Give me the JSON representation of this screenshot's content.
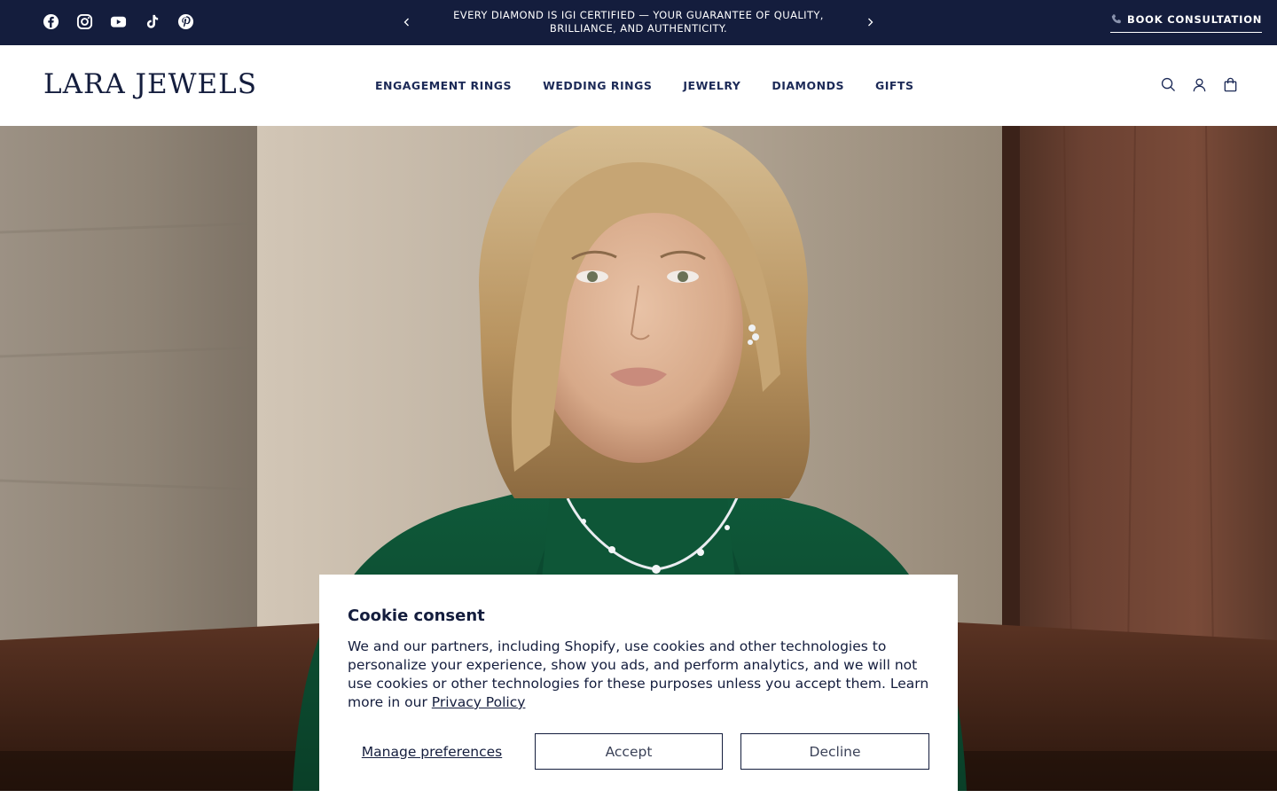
{
  "colors": {
    "navy": "#141d3d",
    "nav_text": "#1c2a57",
    "white": "#ffffff"
  },
  "announcement": {
    "social_icons": [
      "facebook-icon",
      "instagram-icon",
      "youtube-icon",
      "tiktok-icon",
      "pinterest-icon"
    ],
    "text": "EVERY DIAMOND IS IGI CERTIFIED — YOUR GUARANTEE OF QUALITY, BRILLIANCE, AND AUTHENTICITY.",
    "cta": "BOOK CONSULTATION"
  },
  "header": {
    "logo": "LARA JEWELS",
    "nav": [
      "ENGAGEMENT RINGS",
      "WEDDING RINGS",
      "JEWELRY",
      "DIAMONDS",
      "GIFTS"
    ],
    "icons": [
      "search-icon",
      "account-icon",
      "cart-icon"
    ]
  },
  "cookie": {
    "title": "Cookie consent",
    "body": "We and our partners, including Shopify, use cookies and other technologies to personalize your experience, show you ads, and perform analytics, and we will not use cookies or other technologies for these purposes unless you accept them. Learn more in our",
    "link": "Privacy Policy",
    "manage": "Manage preferences",
    "accept": "Accept",
    "decline": "Decline"
  }
}
